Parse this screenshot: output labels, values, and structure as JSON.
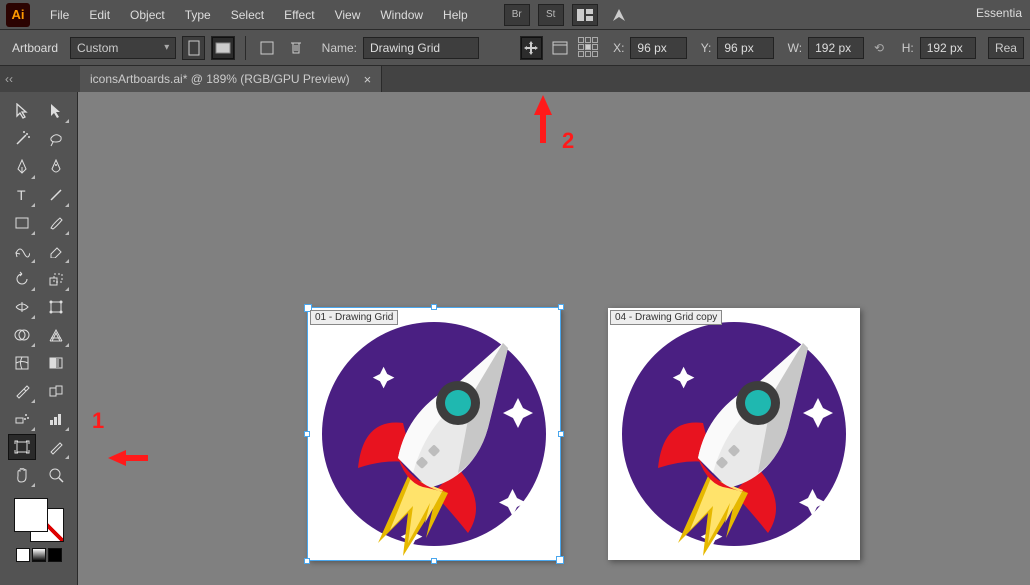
{
  "app": {
    "logo": "Ai",
    "workspace": "Essentia"
  },
  "menu": {
    "items": [
      "File",
      "Edit",
      "Object",
      "Type",
      "Select",
      "Effect",
      "View",
      "Window",
      "Help"
    ],
    "bridge": "Br",
    "stock": "St"
  },
  "options": {
    "tool_label": "Artboard",
    "preset": "Custom",
    "name_label": "Name:",
    "name_value": "Drawing Grid",
    "x_label": "X:",
    "x_value": "96 px",
    "y_label": "Y:",
    "y_value": "96 px",
    "w_label": "W:",
    "w_value": "192 px",
    "h_label": "H:",
    "h_value": "192 px",
    "rea": "Rea"
  },
  "document": {
    "tab_title": "iconsArtboards.ai* @ 189% (RGB/GPU Preview)"
  },
  "artboards": {
    "a": {
      "label": "01 - Drawing Grid"
    },
    "b": {
      "label": "04 - Drawing Grid copy"
    }
  },
  "annotations": {
    "one": "1",
    "two": "2"
  }
}
